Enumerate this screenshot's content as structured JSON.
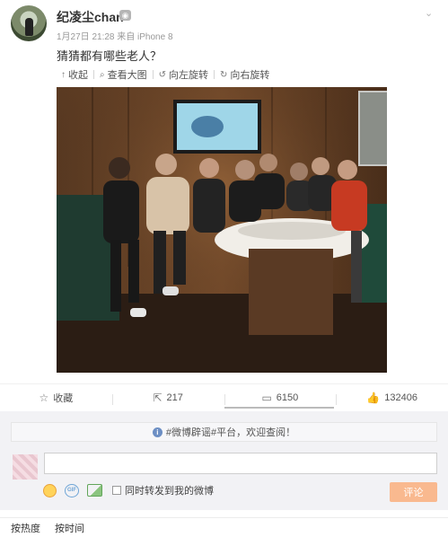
{
  "post": {
    "username": "纪凌尘chan",
    "meta": "1月27日 21:28 来自 iPhone 8",
    "text": "猜猜都有哪些老人？"
  },
  "image_toolbar": {
    "collapse": "收起",
    "view_large": "查看大图",
    "rotate_left": "向左旋转",
    "rotate_right": "向右旋转"
  },
  "actions": {
    "favorite": "收藏",
    "repost": "217",
    "comment": "6150",
    "like": "132406"
  },
  "comment_box": {
    "notice": "#微博辟谣#平台，欢迎查阅！",
    "repost_checkbox": "同时转发到我的微博",
    "submit": "评论"
  },
  "sort": {
    "by_hot": "按热度",
    "by_time": "按时间"
  },
  "icons": [
    "avatar",
    "vip-badge-icon",
    "chevron-down-icon",
    "collapse-icon",
    "zoom-icon",
    "rotate-left-icon",
    "rotate-right-icon",
    "star-icon",
    "repost-icon",
    "comment-icon",
    "like-icon",
    "info-icon",
    "emoji-icon",
    "gif-icon",
    "picture-icon"
  ],
  "colors": {
    "submit_bg": "#f9b98f",
    "notice_icon": "#6d8fc4"
  }
}
